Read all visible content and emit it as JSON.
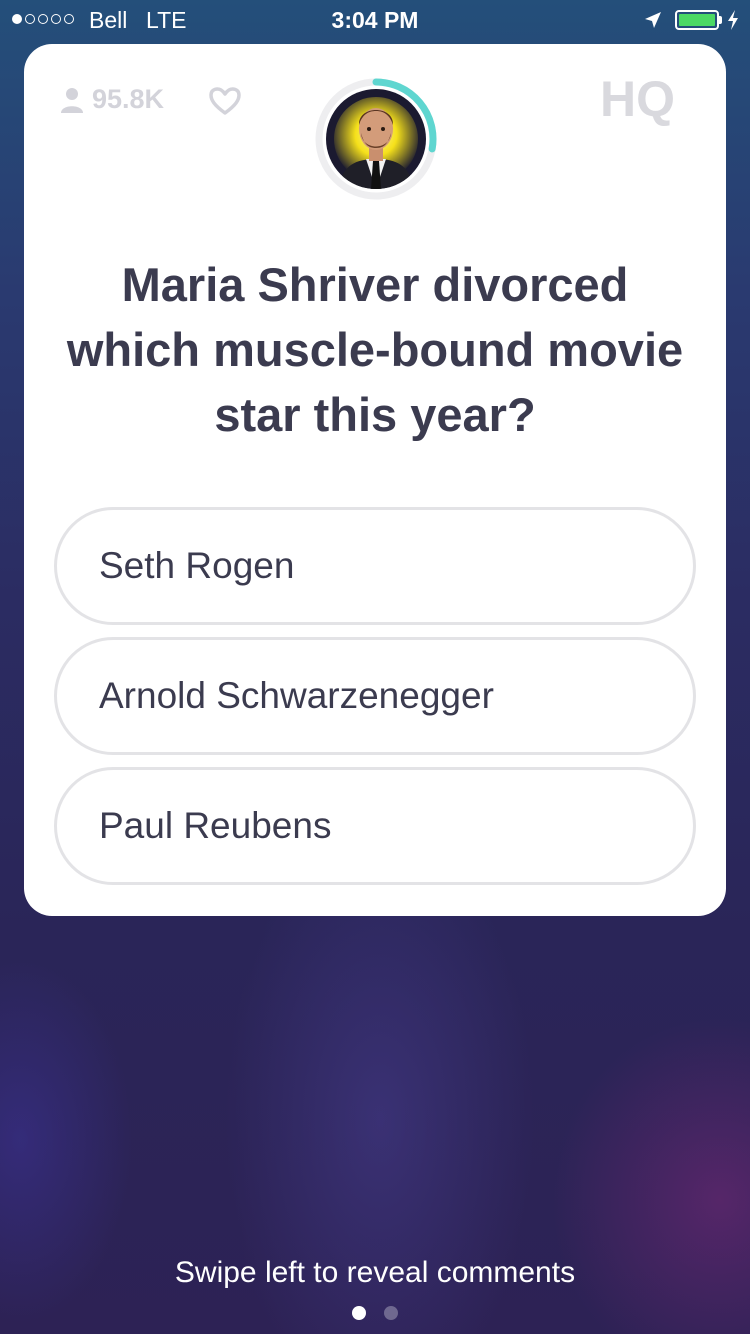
{
  "status_bar": {
    "carrier": "Bell",
    "network": "LTE",
    "time": "3:04 PM",
    "signal_bars_filled": 1,
    "signal_bars_total": 5,
    "battery_color": "#4cd964",
    "icons": [
      "location-arrow-icon",
      "battery-icon",
      "charging-bolt-icon"
    ]
  },
  "card": {
    "viewer_count": "95.8K",
    "logo_text": "HQ",
    "icons": [
      "person-icon",
      "heart-icon",
      "host-avatar",
      "countdown-ring"
    ],
    "timer_color": "#5fd6d0",
    "question": "Maria Shriver divorced which muscle-bound movie star this year?",
    "answers": [
      {
        "label": "Seth Rogen"
      },
      {
        "label": "Arnold Schwarzenegger"
      },
      {
        "label": "Paul Reubens"
      }
    ]
  },
  "footer": {
    "hint": "Swipe left to reveal comments",
    "pages": 2,
    "active_page": 1
  }
}
